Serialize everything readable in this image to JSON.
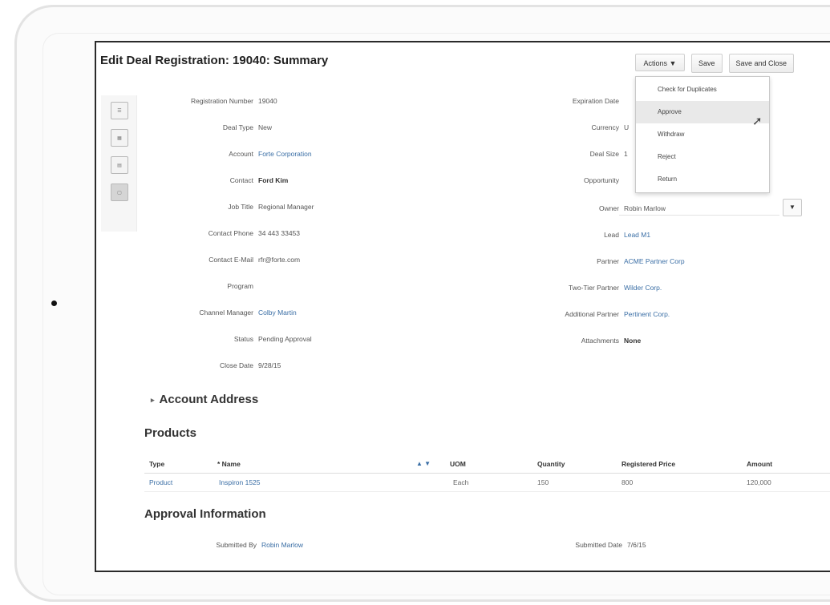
{
  "page": {
    "title": "Edit Deal Registration: 19040: Summary"
  },
  "toolbar": {
    "actions_label": "Actions ▼",
    "save_label": "Save",
    "save_close_label": "Save and Close"
  },
  "actions_menu": {
    "items": [
      "Check for Duplicates",
      "Approve",
      "Withdraw",
      "Reject",
      "Return"
    ],
    "highlighted": "Approve"
  },
  "side_icons": [
    "summary-icon",
    "details-icon",
    "documents-icon",
    "notes-icon"
  ],
  "left_fields": [
    {
      "label": "Registration Number",
      "value": "19040"
    },
    {
      "label": "Deal Type",
      "value": "New"
    },
    {
      "label": "Account",
      "value": "Forte Corporation"
    },
    {
      "label": "Contact",
      "value": "Ford Kim"
    },
    {
      "label": "Job Title",
      "value": "Regional Manager"
    },
    {
      "label": "Contact Phone",
      "value": "34   443   33453"
    },
    {
      "label": "Contact E-Mail",
      "value": "rfr@forte.com"
    },
    {
      "label": "Program",
      "value": ""
    },
    {
      "label": "Channel Manager",
      "value": "Colby Martin"
    },
    {
      "label": "Status",
      "value": "Pending Approval"
    },
    {
      "label": "Close Date",
      "value": "9/28/15"
    }
  ],
  "right_fields": [
    {
      "label": "Expiration Date",
      "value": ""
    },
    {
      "label": "Currency",
      "value": "U"
    },
    {
      "label": "Deal Size",
      "value": "1"
    },
    {
      "label": "Opportunity",
      "value": ""
    },
    {
      "label": "Owner",
      "value": "Robin Marlow"
    },
    {
      "label": "Lead",
      "value": "Lead M1"
    },
    {
      "label": "Partner",
      "value": "ACME Partner Corp"
    },
    {
      "label": "Two-Tier Partner",
      "value": "Wilder Corp."
    },
    {
      "label": "Additional Partner",
      "value": "Pertinent Corp."
    },
    {
      "label": "Attachments",
      "value": "None"
    }
  ],
  "sections": {
    "account_address": "Account Address",
    "products": "Products",
    "approval": "Approval Information"
  },
  "products_table": {
    "columns": [
      "Type",
      "* Name",
      "UOM",
      "Quantity",
      "Registered Price",
      "Amount"
    ],
    "sort_glyph": "▲ ▼",
    "rows": [
      {
        "type": "Product",
        "name": "Inspiron 1525",
        "uom": "Each",
        "quantity": "150",
        "price": "800",
        "amount": "120,000"
      }
    ]
  },
  "approval": {
    "submitted_by_label": "Submitted By",
    "submitted_by": "Robin Marlow",
    "submitted_date_label": "Submitted Date",
    "submitted_date": "7/6/15"
  },
  "owner_select_glyph": "▼"
}
